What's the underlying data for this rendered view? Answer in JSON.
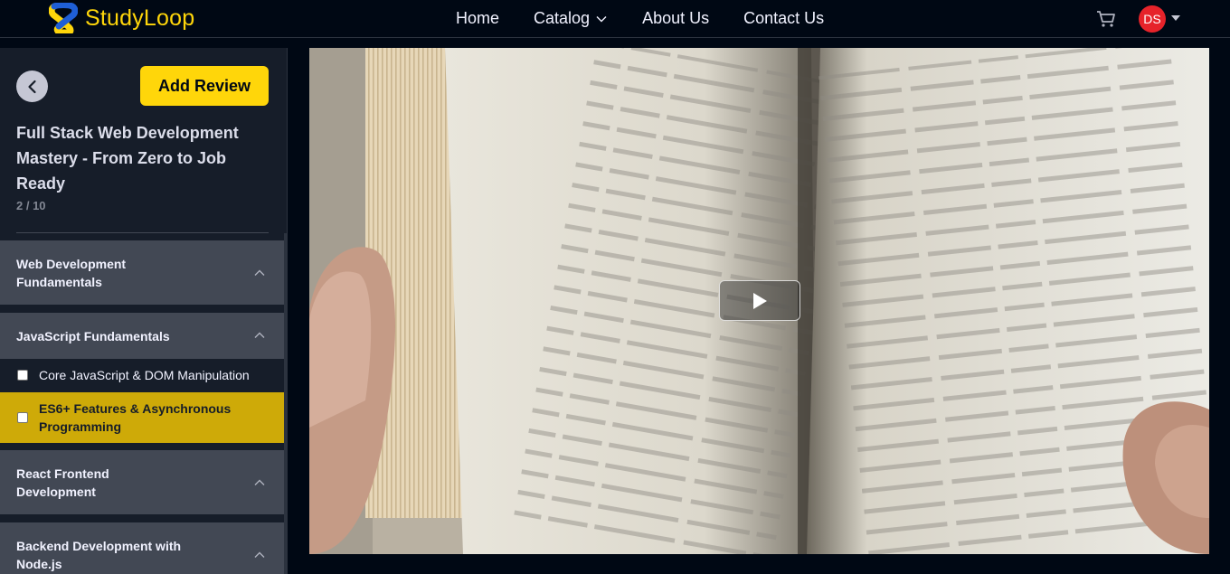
{
  "brand": {
    "name": "StudyLoop",
    "accent": "#ffd60a"
  },
  "nav": {
    "links": [
      "Home",
      "Catalog",
      "About Us",
      "Contact Us"
    ],
    "cart_icon": "cart-icon",
    "avatar_initials": "DS"
  },
  "sidebar": {
    "add_review_label": "Add Review",
    "course_title": "Full Stack Web Development Mastery - From Zero to Job Ready",
    "progress": "2 / 10",
    "sections": [
      {
        "title": "Web Development Fundamentals",
        "expanded": true,
        "lectures": []
      },
      {
        "title": "JavaScript Fundamentals",
        "expanded": true,
        "lectures": [
          {
            "title": "Core JavaScript & DOM Manipulation",
            "completed": false,
            "active": false
          },
          {
            "title": "ES6+ Features & Asynchronous Programming",
            "completed": false,
            "active": true
          }
        ]
      },
      {
        "title": "React Frontend Development",
        "expanded": true,
        "lectures": []
      },
      {
        "title": "Backend Development with Node.js",
        "expanded": true,
        "lectures": []
      }
    ]
  },
  "video": {
    "play_icon": "play-icon"
  }
}
